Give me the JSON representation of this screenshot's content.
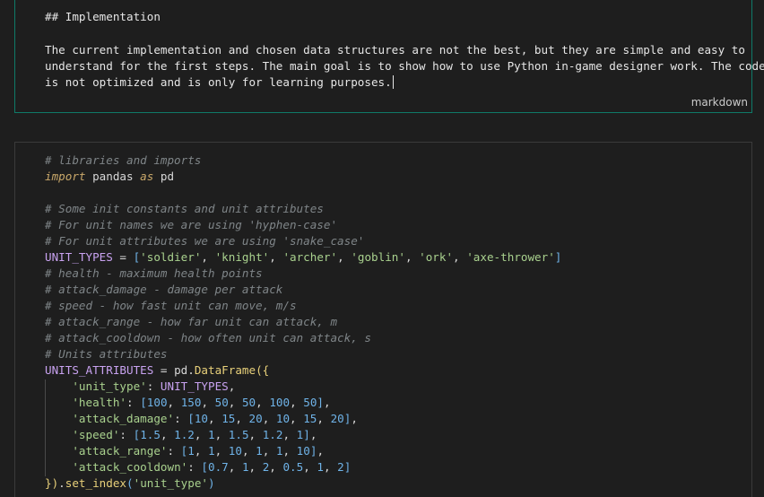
{
  "markdown_cell": {
    "heading": "## Implementation",
    "lines": [
      "The current implementation and chosen data structures are not the best, but they are simple and easy to",
      "understand for the first steps. The main goal is to show how to use Python in-game designer work. The code",
      "is not optimized and is only for learning purposes."
    ],
    "language_label": "markdown",
    "border_color": "#0f7a68"
  },
  "code_cell": {
    "lines": [
      [
        {
          "t": "# libraries and imports",
          "c": "cmt"
        }
      ],
      [
        {
          "t": "import",
          "c": "kw"
        },
        {
          "t": " pandas ",
          "c": "txt"
        },
        {
          "t": "as",
          "c": "kw"
        },
        {
          "t": " pd",
          "c": "txt"
        }
      ],
      [],
      [
        {
          "t": "# Some init constants and unit attributes",
          "c": "cmt"
        }
      ],
      [
        {
          "t": "# For unit names we are using 'hyphen-case'",
          "c": "cmt"
        }
      ],
      [
        {
          "t": "# For unit attributes we are using 'snake_case'",
          "c": "cmt"
        }
      ],
      [
        {
          "t": "UNIT_TYPES",
          "c": "var"
        },
        {
          "t": " = ",
          "c": "txt"
        },
        {
          "t": "[",
          "c": "brk"
        },
        {
          "t": "'soldier'",
          "c": "str"
        },
        {
          "t": ", ",
          "c": "punc"
        },
        {
          "t": "'knight'",
          "c": "str"
        },
        {
          "t": ", ",
          "c": "punc"
        },
        {
          "t": "'archer'",
          "c": "str"
        },
        {
          "t": ", ",
          "c": "punc"
        },
        {
          "t": "'goblin'",
          "c": "str"
        },
        {
          "t": ", ",
          "c": "punc"
        },
        {
          "t": "'ork'",
          "c": "str"
        },
        {
          "t": ", ",
          "c": "punc"
        },
        {
          "t": "'axe-thrower'",
          "c": "str"
        },
        {
          "t": "]",
          "c": "brk"
        }
      ],
      [
        {
          "t": "# health - maximum health points",
          "c": "cmt"
        }
      ],
      [
        {
          "t": "# attack_damage - damage per attack",
          "c": "cmt"
        }
      ],
      [
        {
          "t": "# speed - how fast unit can move, m/s",
          "c": "cmt"
        }
      ],
      [
        {
          "t": "# attack_range - how far unit can attack, m",
          "c": "cmt"
        }
      ],
      [
        {
          "t": "# attack_cooldown - how often unit can attack, s",
          "c": "cmt"
        }
      ],
      [
        {
          "t": "# Units attributes",
          "c": "cmt"
        }
      ],
      [
        {
          "t": "UNITS_ATTRIBUTES",
          "c": "var"
        },
        {
          "t": " = pd.",
          "c": "txt"
        },
        {
          "t": "DataFrame",
          "c": "fn"
        },
        {
          "t": "({",
          "c": "fn"
        }
      ],
      [
        {
          "t": "    ",
          "c": "txt"
        },
        {
          "t": "'unit_type'",
          "c": "str"
        },
        {
          "t": ": ",
          "c": "punc"
        },
        {
          "t": "UNIT_TYPES",
          "c": "var"
        },
        {
          "t": ",",
          "c": "punc"
        }
      ],
      [
        {
          "t": "    ",
          "c": "txt"
        },
        {
          "t": "'health'",
          "c": "str"
        },
        {
          "t": ": ",
          "c": "punc"
        },
        {
          "t": "[",
          "c": "brk"
        },
        {
          "t": "100",
          "c": "num"
        },
        {
          "t": ", ",
          "c": "punc"
        },
        {
          "t": "150",
          "c": "num"
        },
        {
          "t": ", ",
          "c": "punc"
        },
        {
          "t": "50",
          "c": "num"
        },
        {
          "t": ", ",
          "c": "punc"
        },
        {
          "t": "50",
          "c": "num"
        },
        {
          "t": ", ",
          "c": "punc"
        },
        {
          "t": "100",
          "c": "num"
        },
        {
          "t": ", ",
          "c": "punc"
        },
        {
          "t": "50",
          "c": "num"
        },
        {
          "t": "]",
          "c": "brk"
        },
        {
          "t": ",",
          "c": "punc"
        }
      ],
      [
        {
          "t": "    ",
          "c": "txt"
        },
        {
          "t": "'attack_damage'",
          "c": "str"
        },
        {
          "t": ": ",
          "c": "punc"
        },
        {
          "t": "[",
          "c": "brk"
        },
        {
          "t": "10",
          "c": "num"
        },
        {
          "t": ", ",
          "c": "punc"
        },
        {
          "t": "15",
          "c": "num"
        },
        {
          "t": ", ",
          "c": "punc"
        },
        {
          "t": "20",
          "c": "num"
        },
        {
          "t": ", ",
          "c": "punc"
        },
        {
          "t": "10",
          "c": "num"
        },
        {
          "t": ", ",
          "c": "punc"
        },
        {
          "t": "15",
          "c": "num"
        },
        {
          "t": ", ",
          "c": "punc"
        },
        {
          "t": "20",
          "c": "num"
        },
        {
          "t": "]",
          "c": "brk"
        },
        {
          "t": ",",
          "c": "punc"
        }
      ],
      [
        {
          "t": "    ",
          "c": "txt"
        },
        {
          "t": "'speed'",
          "c": "str"
        },
        {
          "t": ": ",
          "c": "punc"
        },
        {
          "t": "[",
          "c": "brk"
        },
        {
          "t": "1.5",
          "c": "num"
        },
        {
          "t": ", ",
          "c": "punc"
        },
        {
          "t": "1.2",
          "c": "num"
        },
        {
          "t": ", ",
          "c": "punc"
        },
        {
          "t": "1",
          "c": "num"
        },
        {
          "t": ", ",
          "c": "punc"
        },
        {
          "t": "1.5",
          "c": "num"
        },
        {
          "t": ", ",
          "c": "punc"
        },
        {
          "t": "1.2",
          "c": "num"
        },
        {
          "t": ", ",
          "c": "punc"
        },
        {
          "t": "1",
          "c": "num"
        },
        {
          "t": "]",
          "c": "brk"
        },
        {
          "t": ",",
          "c": "punc"
        }
      ],
      [
        {
          "t": "    ",
          "c": "txt"
        },
        {
          "t": "'attack_range'",
          "c": "str"
        },
        {
          "t": ": ",
          "c": "punc"
        },
        {
          "t": "[",
          "c": "brk"
        },
        {
          "t": "1",
          "c": "num"
        },
        {
          "t": ", ",
          "c": "punc"
        },
        {
          "t": "1",
          "c": "num"
        },
        {
          "t": ", ",
          "c": "punc"
        },
        {
          "t": "10",
          "c": "num"
        },
        {
          "t": ", ",
          "c": "punc"
        },
        {
          "t": "1",
          "c": "num"
        },
        {
          "t": ", ",
          "c": "punc"
        },
        {
          "t": "1",
          "c": "num"
        },
        {
          "t": ", ",
          "c": "punc"
        },
        {
          "t": "10",
          "c": "num"
        },
        {
          "t": "]",
          "c": "brk"
        },
        {
          "t": ",",
          "c": "punc"
        }
      ],
      [
        {
          "t": "    ",
          "c": "txt"
        },
        {
          "t": "'attack_cooldown'",
          "c": "str"
        },
        {
          "t": ": ",
          "c": "punc"
        },
        {
          "t": "[",
          "c": "brk"
        },
        {
          "t": "0.7",
          "c": "num"
        },
        {
          "t": ", ",
          "c": "punc"
        },
        {
          "t": "1",
          "c": "num"
        },
        {
          "t": ", ",
          "c": "punc"
        },
        {
          "t": "2",
          "c": "num"
        },
        {
          "t": ", ",
          "c": "punc"
        },
        {
          "t": "0.5",
          "c": "num"
        },
        {
          "t": ", ",
          "c": "punc"
        },
        {
          "t": "1",
          "c": "num"
        },
        {
          "t": ", ",
          "c": "punc"
        },
        {
          "t": "2",
          "c": "num"
        },
        {
          "t": "]",
          "c": "brk"
        }
      ],
      [
        {
          "t": "})",
          "c": "fn"
        },
        {
          "t": ".",
          "c": "txt"
        },
        {
          "t": "set_index",
          "c": "fn"
        },
        {
          "t": "(",
          "c": "brk"
        },
        {
          "t": "'unit_type'",
          "c": "str"
        },
        {
          "t": ")",
          "c": "brk"
        }
      ]
    ]
  }
}
